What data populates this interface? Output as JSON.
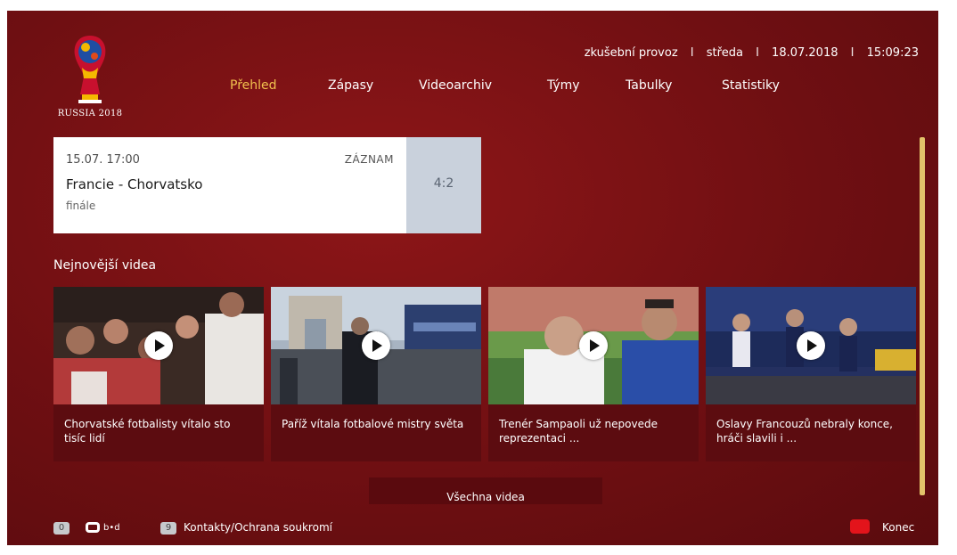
{
  "header": {
    "logo_text": "RUSSIA 2018",
    "status": {
      "mode": "zkušební provoz",
      "separator": "I",
      "weekday": "středa",
      "date": "18.07.2018",
      "time": "15:09:23"
    },
    "nav": [
      {
        "label": "Přehled",
        "active": true
      },
      {
        "label": "Zápasy",
        "active": false
      },
      {
        "label": "Videoarchiv",
        "active": false
      },
      {
        "label": "Týmy",
        "active": false
      },
      {
        "label": "Tabulky",
        "active": false
      },
      {
        "label": "Statistiky",
        "active": false
      }
    ]
  },
  "match": {
    "datetime": "15.07. 17:00",
    "badge": "ZÁZNAM",
    "teams": "Francie - Chorvatsko",
    "stage": "finále",
    "score": "4:2"
  },
  "videos": {
    "section_title": "Nejnovější videa",
    "items": [
      {
        "title": "Chorvatské fotbalisty vítalo sto tisíc lidí"
      },
      {
        "title": "Paříž vítala fotbalové mistry světa"
      },
      {
        "title": "Trenér Sampaoli už nepovede reprezentaci ..."
      },
      {
        "title": "Oslavy Francouzů nebraly konce, hráči slavili i ..."
      }
    ],
    "all_label": "Všechna videa"
  },
  "footer": {
    "key_0": "0",
    "bed_label": "b•d",
    "key_9": "9",
    "contacts_label": "Kontakty/Ochrana soukromí",
    "exit_label": "Konec"
  },
  "colors": {
    "background": "#7a1013",
    "accent_active_nav": "#f2c14e",
    "scrollbar": "#e3c36a",
    "score_box": "#c9d1dc",
    "exit_key": "#e3141b"
  }
}
